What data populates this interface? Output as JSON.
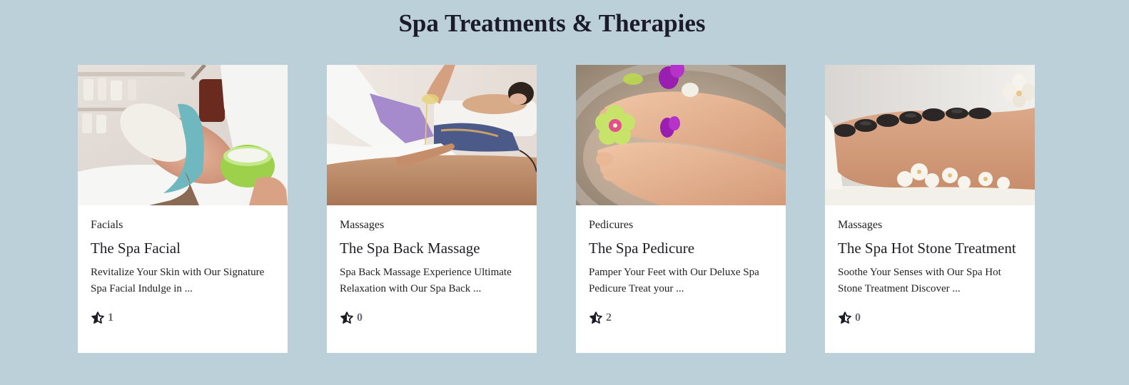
{
  "page": {
    "title": "Spa Treatments & Therapies"
  },
  "cards": [
    {
      "image_alt": "woman receiving facial mask",
      "category": "Facials",
      "title": "The Spa Facial",
      "description": "Revitalize Your Skin with Our Signature Spa Facial Indulge in ...",
      "rating_count": "1",
      "icon": "star-icon"
    },
    {
      "image_alt": "oil being poured for back massage",
      "category": "Massages",
      "title": "The Spa Back Massage",
      "description": "Spa Back Massage Experience Ultimate Relaxation with Our Spa Back ...",
      "rating_count": "0",
      "icon": "star-icon"
    },
    {
      "image_alt": "feet in water with orchids",
      "category": "Pedicures",
      "title": "The Spa Pedicure",
      "description": "Pamper Your Feet with Our Deluxe Spa Pedicure Treat your ...",
      "rating_count": "2",
      "icon": "star-icon"
    },
    {
      "image_alt": "hot stones on back",
      "category": "Massages",
      "title": "The Spa Hot Stone Treatment",
      "description": "Soothe Your Senses with Our Spa Hot Stone Treatment Discover ...",
      "rating_count": "0",
      "icon": "star-icon"
    }
  ],
  "colors": {
    "background": "#bbd0d8",
    "card": "#ffffff",
    "text": "#1f1f2b",
    "rating": "#6b6b73"
  }
}
